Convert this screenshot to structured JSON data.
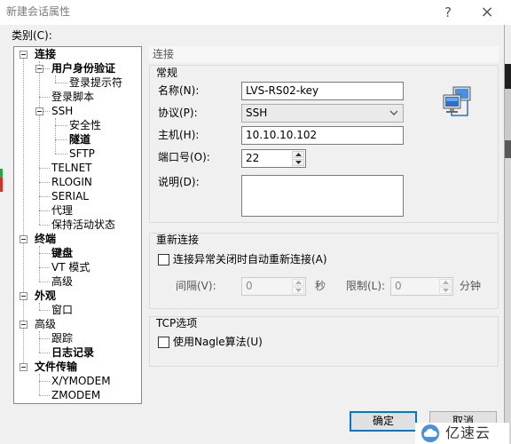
{
  "window": {
    "title": "新建会话属性",
    "help": "?",
    "close": "×"
  },
  "category_label": "类别(C):",
  "tree": [
    {
      "label": "连接",
      "expanded": true
    },
    {
      "label": "用户身份验证",
      "expanded": true
    },
    {
      "label": "登录提示符"
    },
    {
      "label": "登录脚本"
    },
    {
      "label": "SSH",
      "expanded": true
    },
    {
      "label": "安全性"
    },
    {
      "label": "隧道"
    },
    {
      "label": "SFTP"
    },
    {
      "label": "TELNET"
    },
    {
      "label": "RLOGIN"
    },
    {
      "label": "SERIAL"
    },
    {
      "label": "代理"
    },
    {
      "label": "保持活动状态"
    },
    {
      "label": "终端",
      "expanded": true
    },
    {
      "label": "键盘"
    },
    {
      "label": "VT 模式"
    },
    {
      "label": "高级"
    },
    {
      "label": "外观",
      "expanded": true
    },
    {
      "label": "窗口"
    },
    {
      "label": "高级",
      "expanded": true
    },
    {
      "label": "跟踪"
    },
    {
      "label": "日志记录"
    },
    {
      "label": "文件传输",
      "expanded": true
    },
    {
      "label": "X/YMODEM"
    },
    {
      "label": "ZMODEM"
    }
  ],
  "panel": {
    "header": "连接"
  },
  "general": {
    "title": "常规",
    "name_label": "名称(N):",
    "name_value": "LVS-RS02-key",
    "protocol_label": "协议(P):",
    "protocol_value": "SSH",
    "host_label": "主机(H):",
    "host_value": "10.10.10.102",
    "port_label": "端口号(O):",
    "port_value": "22",
    "desc_label": "说明(D):"
  },
  "reconnect": {
    "title": "重新连接",
    "auto_reconnect_label": "连接异常关闭时自动重新连接(A)",
    "auto_reconnect_checked": false,
    "interval_label": "间隔(V):",
    "interval_value": "0",
    "interval_unit": "秒",
    "limit_label": "限制(L):",
    "limit_value": "0",
    "limit_unit": "分钟"
  },
  "tcp": {
    "title": "TCP选项",
    "nagle_label": "使用Nagle算法(U)",
    "nagle_checked": false
  },
  "buttons": {
    "ok": "确定",
    "cancel": "取消"
  },
  "watermark": {
    "text": "亿速云"
  },
  "icons": {
    "expander": "collapse-icon",
    "session": "network-computers-icon",
    "dropdown": "chevron-down-icon",
    "spin_up": "spin-up-icon",
    "spin_down": "spin-down-icon",
    "watermark_logo": "cloud-logo-icon"
  },
  "colors": {
    "dialog_bg": "#f0f0f0",
    "default_button_border": "#0078d7",
    "tree_bg": "#ffffff"
  }
}
